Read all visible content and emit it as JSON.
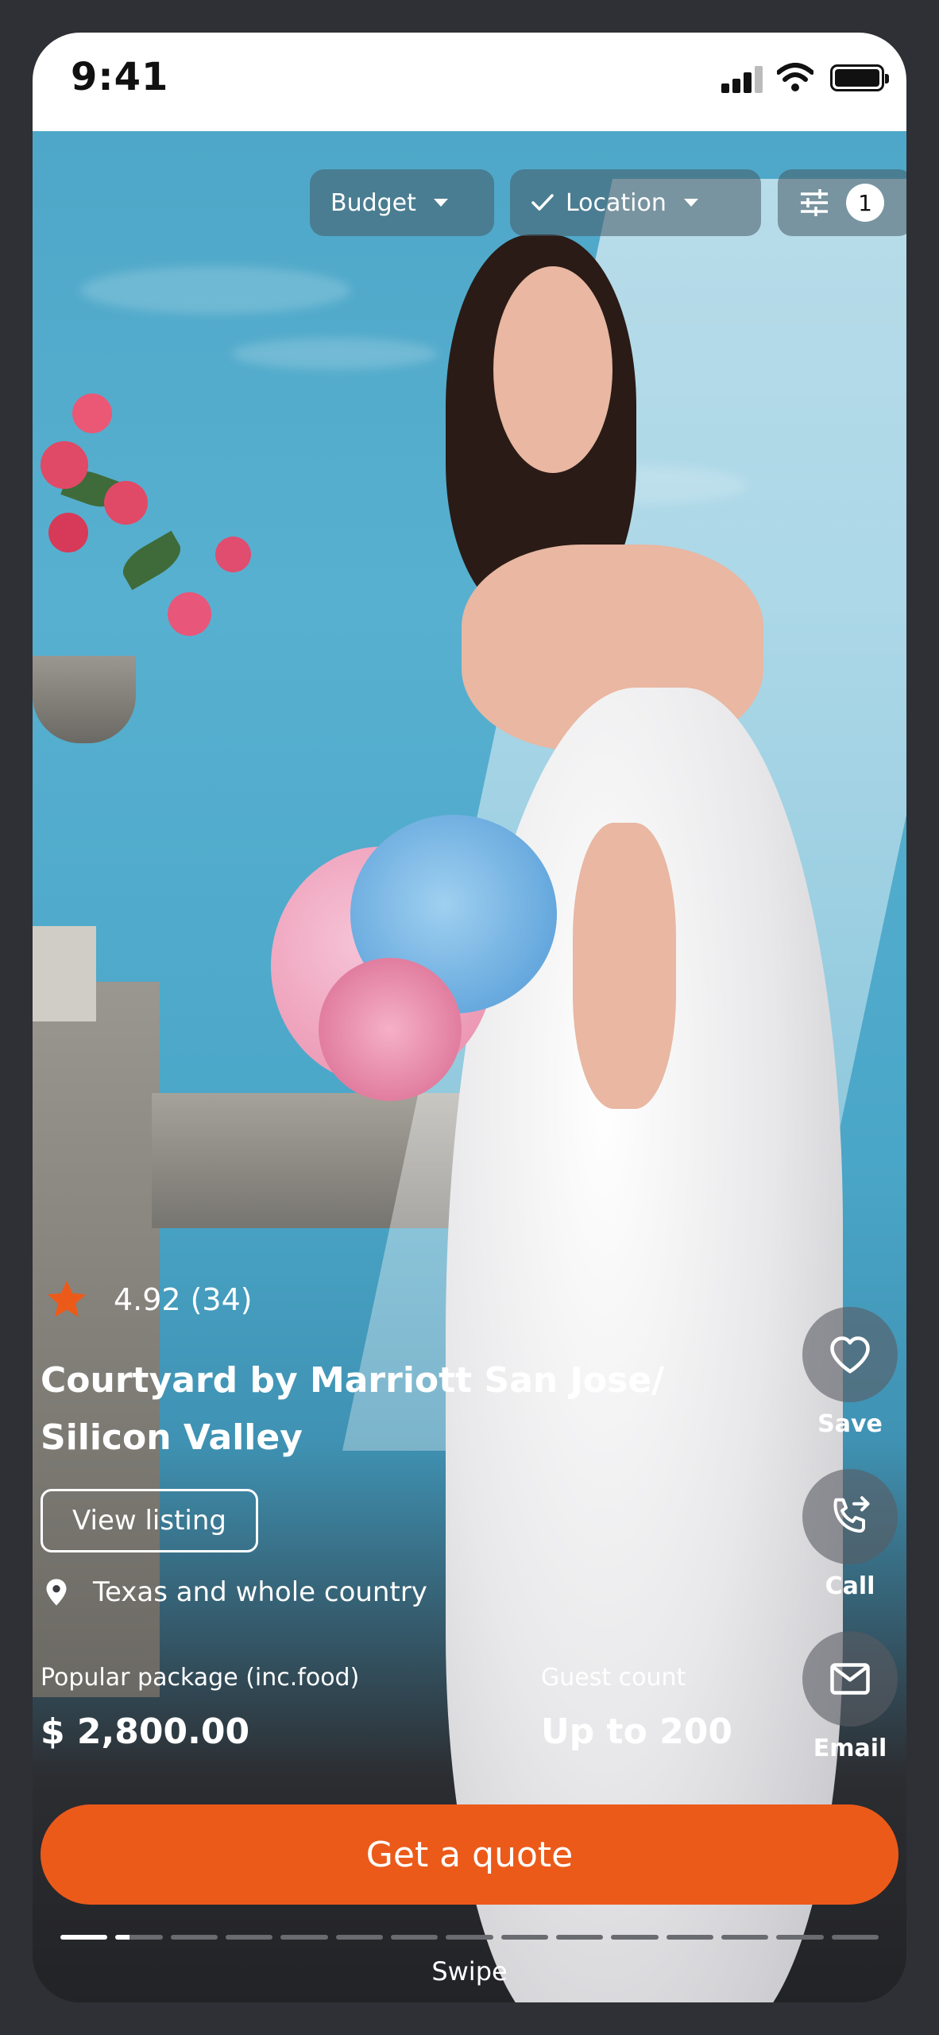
{
  "status_bar": {
    "time": "9:41"
  },
  "filters": {
    "budget_label": "Budget",
    "location_label": "Location",
    "filter_count": "1"
  },
  "listing": {
    "rating": "4.92",
    "reviews": "(34)",
    "title_line1": "Courtyard by Marriott San Jose/",
    "title_line2": "Silicon Valley",
    "view_label": "View listing",
    "location": "Texas and whole country",
    "package_label": "Popular package (inc.food)",
    "package_price": "$ 2,800.00",
    "guest_label": "Guest count",
    "guest_value": "Up to 200"
  },
  "actions": {
    "save": "Save",
    "call": "Call",
    "email": "Email"
  },
  "cta": {
    "quote": "Get a quote"
  },
  "pager": {
    "swipe": "Swipe",
    "total": 15,
    "current": 1
  },
  "colors": {
    "accent": "#ec5a1a",
    "star": "#ec5a1a",
    "chip_bg": "rgba(70,90,100,0.55)"
  }
}
